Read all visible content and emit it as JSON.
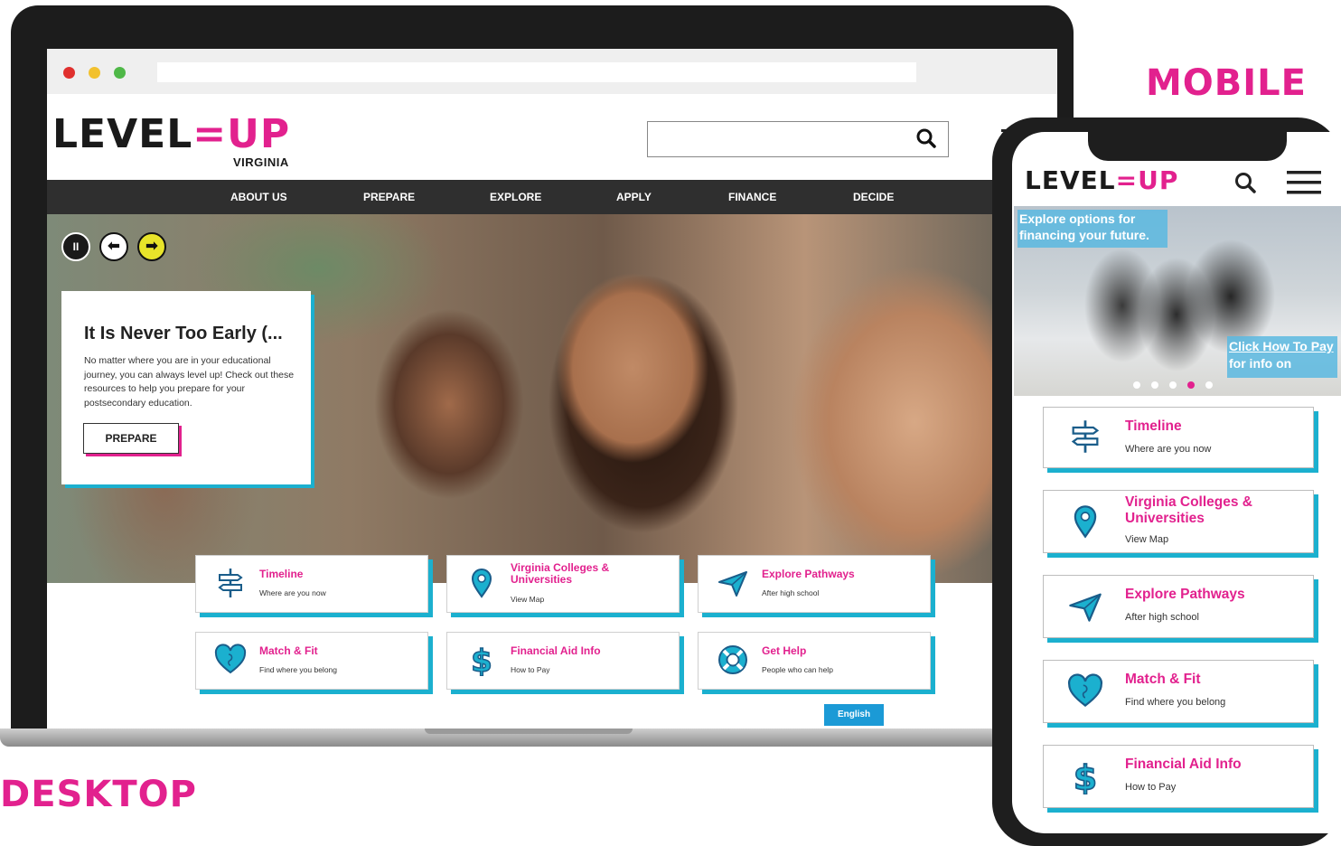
{
  "labels": {
    "desktop": "DESKTOP",
    "mobile": "MOBILE"
  },
  "colors": {
    "brand_pink": "#e2218e",
    "accent_cyan": "#1bb0cf",
    "nav_dark": "#2f2f2f",
    "button_blue": "#1b9ad6"
  },
  "brand": {
    "logo_left": "LEVEL",
    "logo_right": "UP",
    "logo_sub": "VIRGINIA"
  },
  "desktop": {
    "search": {
      "placeholder": "",
      "icon": "search-icon"
    },
    "nav": [
      "ABOUT US",
      "PREPARE",
      "EXPLORE",
      "APPLY",
      "FINANCE",
      "DECIDE"
    ],
    "slider_controls": [
      "pause-icon",
      "arrow-left-icon",
      "arrow-right-icon"
    ],
    "hero": {
      "title": "It Is Never Too Early (...",
      "body": "No matter where you are in your educational journey, you can always level up! Check out these resources to help you prepare for your postsecondary education.",
      "button": "PREPARE"
    },
    "cards": [
      {
        "title": "Timeline",
        "subtitle": "Where are you now",
        "icon": "signpost-icon"
      },
      {
        "title": "Virginia Colleges & Universities",
        "subtitle": "View Map",
        "icon": "map-pin-icon"
      },
      {
        "title": "Explore Pathways",
        "subtitle": "After high school",
        "icon": "paper-plane-icon"
      },
      {
        "title": "Match & Fit",
        "subtitle": "Find where you belong",
        "icon": "heart-puzzle-icon"
      },
      {
        "title": "Financial Aid Info",
        "subtitle": "How to Pay",
        "icon": "dollar-icon"
      },
      {
        "title": "Get Help",
        "subtitle": "People who can help",
        "icon": "lifebuoy-icon"
      }
    ],
    "language_button": "English"
  },
  "mobile": {
    "hero_caption_top": "Explore options for financing your future.",
    "hero_caption_link": "Click How To Pay",
    "hero_caption_rest": " for info on",
    "slide_count": 5,
    "active_slide": 4,
    "cards": [
      {
        "title": "Timeline",
        "subtitle": "Where are you now",
        "icon": "signpost-icon"
      },
      {
        "title": "Virginia Colleges & Universities",
        "subtitle": "View Map",
        "icon": "map-pin-icon"
      },
      {
        "title": "Explore Pathways",
        "subtitle": "After high school",
        "icon": "paper-plane-icon"
      },
      {
        "title": "Match & Fit",
        "subtitle": "Find where you belong",
        "icon": "heart-puzzle-icon"
      },
      {
        "title": "Financial Aid Info",
        "subtitle": "How to Pay",
        "icon": "dollar-icon"
      }
    ]
  }
}
